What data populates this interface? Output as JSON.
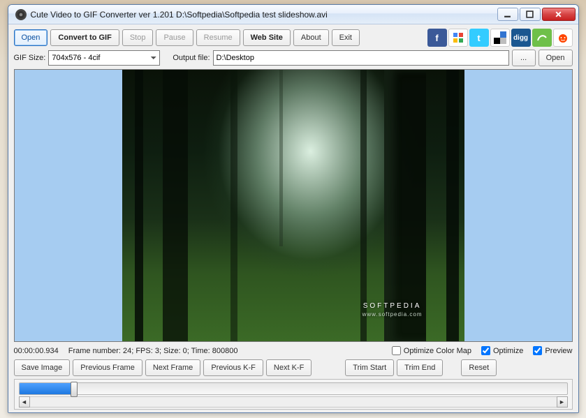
{
  "window": {
    "title": "Cute Video to GIF Converter ver 1.201  D:\\Softpedia\\Softpedia test slideshow.avi"
  },
  "toolbar": {
    "open": "Open",
    "convert": "Convert to GIF",
    "stop": "Stop",
    "pause": "Pause",
    "resume": "Resume",
    "website": "Web Site",
    "about": "About",
    "exit": "Exit"
  },
  "filebar": {
    "gif_size_label": "GIF Size:",
    "gif_size_value": "704x576 - 4cif",
    "output_label": "Output file:",
    "output_value": "D:\\Desktop",
    "browse": "...",
    "open": "Open"
  },
  "preview": {
    "watermark": "SOFTPEDIA",
    "watermark_sub": "www.softpedia.com"
  },
  "status": {
    "time": "00:00:00.934",
    "details": "Frame number: 24; FPS: 3; Size: 0; Time: 800800",
    "optimize_color_map": "Optimize Color Map",
    "optimize": "Optimize",
    "preview": "Preview",
    "optimize_color_map_checked": false,
    "optimize_checked": true,
    "preview_checked": true
  },
  "controls": {
    "save_image": "Save Image",
    "previous_frame": "Previous Frame",
    "next_frame": "Next Frame",
    "previous_kf": "Previous K-F",
    "next_kf": "Next K-F",
    "trim_start": "Trim Start",
    "trim_end": "Trim End",
    "reset": "Reset"
  },
  "slider": {
    "percent": 10
  },
  "social": {
    "facebook": "f",
    "twitter": "t",
    "digg": "digg"
  }
}
